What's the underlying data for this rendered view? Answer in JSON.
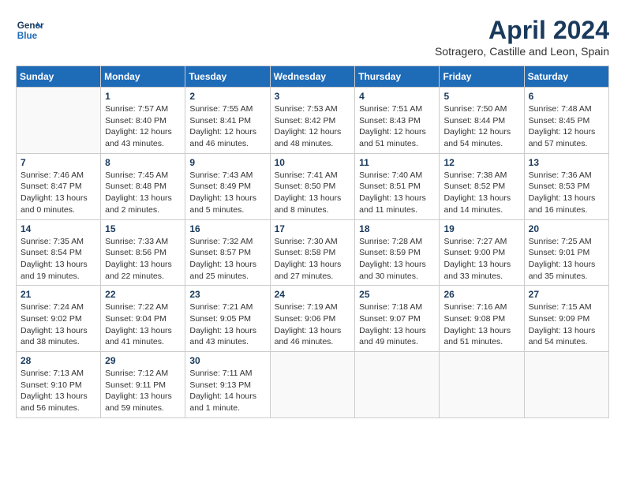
{
  "logo": {
    "line1": "General",
    "line2": "Blue"
  },
  "title": "April 2024",
  "subtitle": "Sotragero, Castille and Leon, Spain",
  "days_of_week": [
    "Sunday",
    "Monday",
    "Tuesday",
    "Wednesday",
    "Thursday",
    "Friday",
    "Saturday"
  ],
  "weeks": [
    [
      {
        "num": "",
        "detail": ""
      },
      {
        "num": "1",
        "detail": "Sunrise: 7:57 AM\nSunset: 8:40 PM\nDaylight: 12 hours\nand 43 minutes."
      },
      {
        "num": "2",
        "detail": "Sunrise: 7:55 AM\nSunset: 8:41 PM\nDaylight: 12 hours\nand 46 minutes."
      },
      {
        "num": "3",
        "detail": "Sunrise: 7:53 AM\nSunset: 8:42 PM\nDaylight: 12 hours\nand 48 minutes."
      },
      {
        "num": "4",
        "detail": "Sunrise: 7:51 AM\nSunset: 8:43 PM\nDaylight: 12 hours\nand 51 minutes."
      },
      {
        "num": "5",
        "detail": "Sunrise: 7:50 AM\nSunset: 8:44 PM\nDaylight: 12 hours\nand 54 minutes."
      },
      {
        "num": "6",
        "detail": "Sunrise: 7:48 AM\nSunset: 8:45 PM\nDaylight: 12 hours\nand 57 minutes."
      }
    ],
    [
      {
        "num": "7",
        "detail": "Sunrise: 7:46 AM\nSunset: 8:47 PM\nDaylight: 13 hours\nand 0 minutes."
      },
      {
        "num": "8",
        "detail": "Sunrise: 7:45 AM\nSunset: 8:48 PM\nDaylight: 13 hours\nand 2 minutes."
      },
      {
        "num": "9",
        "detail": "Sunrise: 7:43 AM\nSunset: 8:49 PM\nDaylight: 13 hours\nand 5 minutes."
      },
      {
        "num": "10",
        "detail": "Sunrise: 7:41 AM\nSunset: 8:50 PM\nDaylight: 13 hours\nand 8 minutes."
      },
      {
        "num": "11",
        "detail": "Sunrise: 7:40 AM\nSunset: 8:51 PM\nDaylight: 13 hours\nand 11 minutes."
      },
      {
        "num": "12",
        "detail": "Sunrise: 7:38 AM\nSunset: 8:52 PM\nDaylight: 13 hours\nand 14 minutes."
      },
      {
        "num": "13",
        "detail": "Sunrise: 7:36 AM\nSunset: 8:53 PM\nDaylight: 13 hours\nand 16 minutes."
      }
    ],
    [
      {
        "num": "14",
        "detail": "Sunrise: 7:35 AM\nSunset: 8:54 PM\nDaylight: 13 hours\nand 19 minutes."
      },
      {
        "num": "15",
        "detail": "Sunrise: 7:33 AM\nSunset: 8:56 PM\nDaylight: 13 hours\nand 22 minutes."
      },
      {
        "num": "16",
        "detail": "Sunrise: 7:32 AM\nSunset: 8:57 PM\nDaylight: 13 hours\nand 25 minutes."
      },
      {
        "num": "17",
        "detail": "Sunrise: 7:30 AM\nSunset: 8:58 PM\nDaylight: 13 hours\nand 27 minutes."
      },
      {
        "num": "18",
        "detail": "Sunrise: 7:28 AM\nSunset: 8:59 PM\nDaylight: 13 hours\nand 30 minutes."
      },
      {
        "num": "19",
        "detail": "Sunrise: 7:27 AM\nSunset: 9:00 PM\nDaylight: 13 hours\nand 33 minutes."
      },
      {
        "num": "20",
        "detail": "Sunrise: 7:25 AM\nSunset: 9:01 PM\nDaylight: 13 hours\nand 35 minutes."
      }
    ],
    [
      {
        "num": "21",
        "detail": "Sunrise: 7:24 AM\nSunset: 9:02 PM\nDaylight: 13 hours\nand 38 minutes."
      },
      {
        "num": "22",
        "detail": "Sunrise: 7:22 AM\nSunset: 9:04 PM\nDaylight: 13 hours\nand 41 minutes."
      },
      {
        "num": "23",
        "detail": "Sunrise: 7:21 AM\nSunset: 9:05 PM\nDaylight: 13 hours\nand 43 minutes."
      },
      {
        "num": "24",
        "detail": "Sunrise: 7:19 AM\nSunset: 9:06 PM\nDaylight: 13 hours\nand 46 minutes."
      },
      {
        "num": "25",
        "detail": "Sunrise: 7:18 AM\nSunset: 9:07 PM\nDaylight: 13 hours\nand 49 minutes."
      },
      {
        "num": "26",
        "detail": "Sunrise: 7:16 AM\nSunset: 9:08 PM\nDaylight: 13 hours\nand 51 minutes."
      },
      {
        "num": "27",
        "detail": "Sunrise: 7:15 AM\nSunset: 9:09 PM\nDaylight: 13 hours\nand 54 minutes."
      }
    ],
    [
      {
        "num": "28",
        "detail": "Sunrise: 7:13 AM\nSunset: 9:10 PM\nDaylight: 13 hours\nand 56 minutes."
      },
      {
        "num": "29",
        "detail": "Sunrise: 7:12 AM\nSunset: 9:11 PM\nDaylight: 13 hours\nand 59 minutes."
      },
      {
        "num": "30",
        "detail": "Sunrise: 7:11 AM\nSunset: 9:13 PM\nDaylight: 14 hours\nand 1 minute."
      },
      {
        "num": "",
        "detail": ""
      },
      {
        "num": "",
        "detail": ""
      },
      {
        "num": "",
        "detail": ""
      },
      {
        "num": "",
        "detail": ""
      }
    ]
  ]
}
